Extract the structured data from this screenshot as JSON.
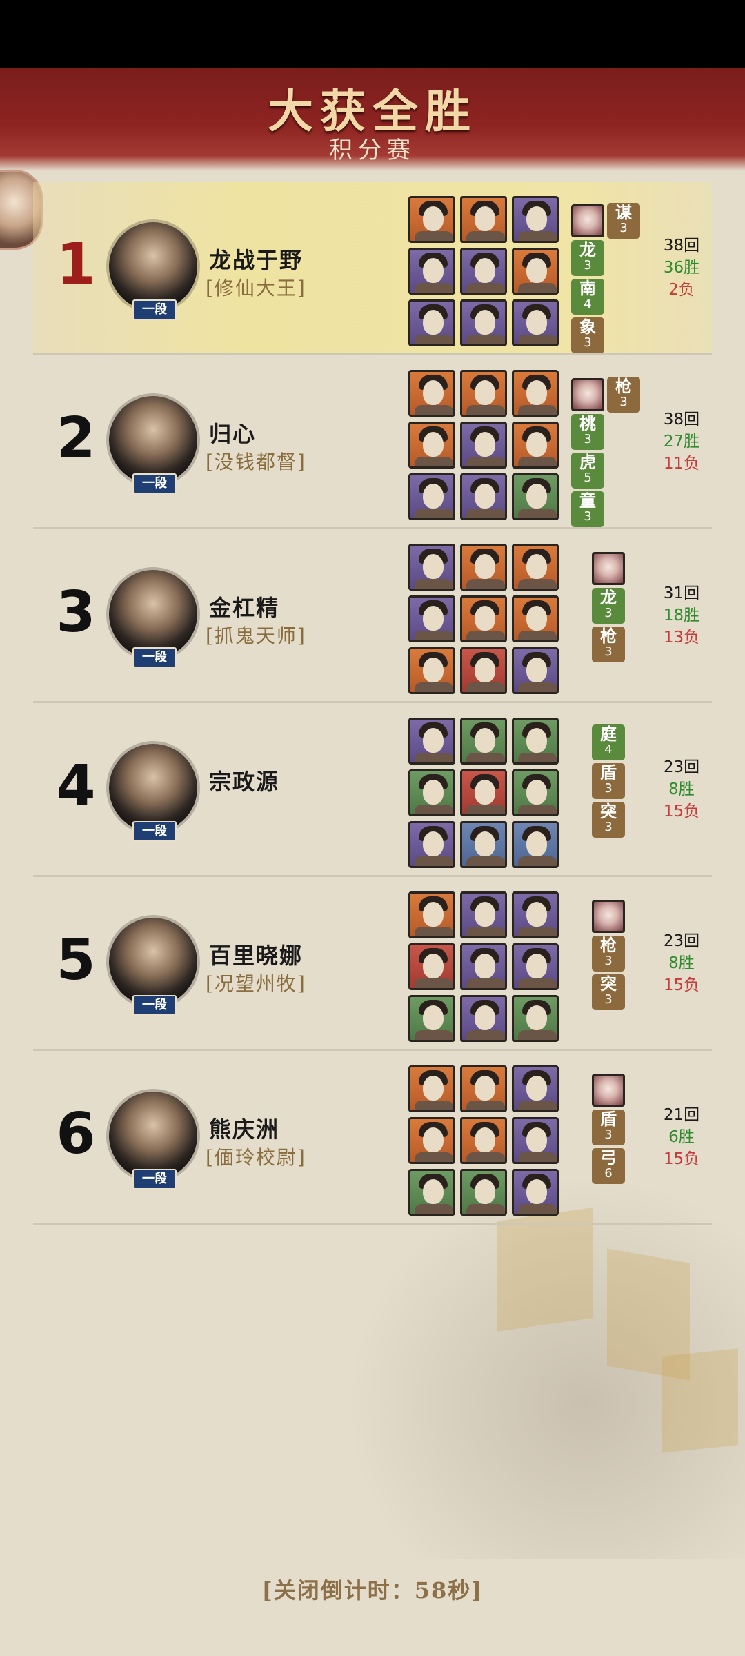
{
  "header": {
    "title": "大获全胜",
    "subtitle": "积分赛"
  },
  "colors": {
    "banner": "#8d2421",
    "rank_badge": "#1f3f74",
    "tag_green": "#5a8a3c",
    "tag_brown": "#8d6a3e",
    "wins": "#2e8b2e",
    "losses": "#c63b3b"
  },
  "rows": [
    {
      "rank": "1",
      "name": "龙战于野",
      "title": "[修仙大王]",
      "badge": "一段",
      "grid": [
        "orange",
        "orange",
        "purple",
        "purple",
        "purple",
        "orange",
        "purple",
        "purple",
        "purple"
      ],
      "lord_icon": "lord-portrait-icon",
      "tags": [
        {
          "char": "谋",
          "lv": "3",
          "color": "brown"
        },
        {
          "char": "龙",
          "lv": "3",
          "color": "green"
        },
        {
          "char": "南",
          "lv": "4",
          "color": "green"
        },
        {
          "char": "象",
          "lv": "3",
          "color": "brown"
        }
      ],
      "rounds": "38回",
      "wins": "36胜",
      "losses": "2负"
    },
    {
      "rank": "2",
      "name": "归心",
      "title": "[没钱都督]",
      "badge": "一段",
      "grid": [
        "orange",
        "orange",
        "orange",
        "orange",
        "purple",
        "orange",
        "purple",
        "purple",
        "green"
      ],
      "lord_icon": "lord-portrait-icon",
      "tags": [
        {
          "char": "枪",
          "lv": "3",
          "color": "brown"
        },
        {
          "char": "桃",
          "lv": "3",
          "color": "green"
        },
        {
          "char": "虎",
          "lv": "5",
          "color": "green"
        },
        {
          "char": "童",
          "lv": "3",
          "color": "green"
        }
      ],
      "rounds": "38回",
      "wins": "27胜",
      "losses": "11负"
    },
    {
      "rank": "3",
      "name": "金杠精",
      "title": "[抓鬼天师]",
      "badge": "一段",
      "grid": [
        "purple",
        "orange",
        "orange",
        "purple",
        "orange",
        "orange",
        "orange",
        "red",
        "purple"
      ],
      "lord_icon": "lord-portrait-icon",
      "tags": [
        {
          "char": "龙",
          "lv": "3",
          "color": "green"
        },
        {
          "char": "枪",
          "lv": "3",
          "color": "brown"
        }
      ],
      "rounds": "31回",
      "wins": "18胜",
      "losses": "13负"
    },
    {
      "rank": "4",
      "name": "宗政源",
      "title": "",
      "badge": "一段",
      "grid": [
        "purple",
        "green",
        "green",
        "green",
        "red",
        "green",
        "purple",
        "blue",
        "blue"
      ],
      "lord_icon": "",
      "tags": [
        {
          "char": "庭",
          "lv": "4",
          "color": "green"
        },
        {
          "char": "盾",
          "lv": "3",
          "color": "brown"
        },
        {
          "char": "突",
          "lv": "3",
          "color": "brown"
        }
      ],
      "rounds": "23回",
      "wins": "8胜",
      "losses": "15负"
    },
    {
      "rank": "5",
      "name": "百里晓娜",
      "title": "[况望州牧]",
      "badge": "一段",
      "grid": [
        "orange",
        "purple",
        "purple",
        "red",
        "purple",
        "purple",
        "green",
        "purple",
        "green"
      ],
      "lord_icon": "lord-portrait-icon",
      "tags": [
        {
          "char": "枪",
          "lv": "3",
          "color": "brown"
        },
        {
          "char": "突",
          "lv": "3",
          "color": "brown"
        }
      ],
      "rounds": "23回",
      "wins": "8胜",
      "losses": "15负"
    },
    {
      "rank": "6",
      "name": "熊庆洲",
      "title": "[偭玲校尉]",
      "badge": "一段",
      "grid": [
        "orange",
        "orange",
        "purple",
        "orange",
        "orange",
        "purple",
        "green",
        "green",
        "purple"
      ],
      "lord_icon": "lord-portrait-icon",
      "tags": [
        {
          "char": "盾",
          "lv": "3",
          "color": "brown"
        },
        {
          "char": "弓",
          "lv": "6",
          "color": "brown"
        }
      ],
      "rounds": "21回",
      "wins": "6胜",
      "losses": "15负"
    }
  ],
  "footer": {
    "countdown": "[关闭倒计时：58秒]"
  }
}
